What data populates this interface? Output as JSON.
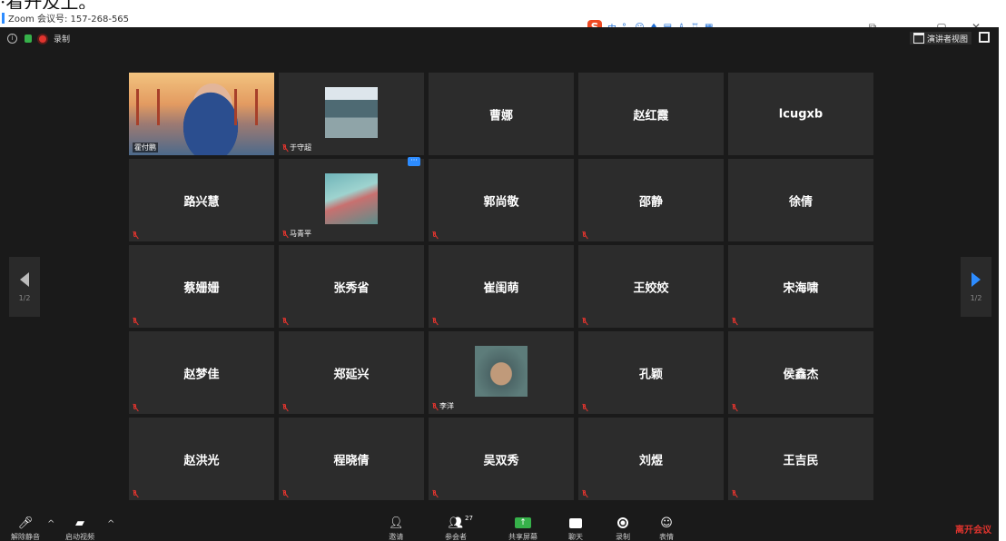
{
  "caption": "·看升及上。",
  "window": {
    "title": "Zoom 会议号: 157-268-565",
    "controls": [
      "—",
      "▢",
      "✕"
    ]
  },
  "ime_toolbar": {
    "logo": "S",
    "label": "中"
  },
  "meeting_header": {
    "recording_label": "录制",
    "speaker_view_label": "演讲者视图"
  },
  "pagination": {
    "left_page": "1/2",
    "right_page": "1/2"
  },
  "participants": [
    {
      "name": "霍付鹏",
      "type": "video",
      "muted": false,
      "active": true
    },
    {
      "name": "于守超",
      "type": "avatar",
      "avatar": "classroom",
      "muted": true
    },
    {
      "name": "曹娜",
      "type": "name",
      "muted": false
    },
    {
      "name": "赵红霞",
      "type": "name",
      "muted": false
    },
    {
      "name": "lcugxb",
      "type": "name",
      "muted": false
    },
    {
      "name": "路兴慧",
      "type": "name",
      "muted": true
    },
    {
      "name": "马青平",
      "type": "avatar",
      "avatar": "girl",
      "muted": true,
      "more": "···"
    },
    {
      "name": "郭尚敬",
      "type": "name",
      "muted": true
    },
    {
      "name": "邵静",
      "type": "name",
      "muted": true
    },
    {
      "name": "徐倩",
      "type": "name",
      "muted": false
    },
    {
      "name": "蔡姗姗",
      "type": "name",
      "muted": true
    },
    {
      "name": "张秀省",
      "type": "name",
      "muted": true
    },
    {
      "name": "崔闺萌",
      "type": "name",
      "muted": true
    },
    {
      "name": "王姣姣",
      "type": "name",
      "muted": true
    },
    {
      "name": "宋海啸",
      "type": "name",
      "muted": true
    },
    {
      "name": "赵梦佳",
      "type": "name",
      "muted": true
    },
    {
      "name": "郑延兴",
      "type": "name",
      "muted": true
    },
    {
      "name": "李洋",
      "type": "avatar",
      "avatar": "soldier",
      "muted": true
    },
    {
      "name": "孔颖",
      "type": "name",
      "muted": true
    },
    {
      "name": "侯鑫杰",
      "type": "name",
      "muted": true
    },
    {
      "name": "赵洪光",
      "type": "name",
      "muted": true
    },
    {
      "name": "程晓倩",
      "type": "name",
      "muted": true
    },
    {
      "name": "吴双秀",
      "type": "name",
      "muted": true
    },
    {
      "name": "刘煜",
      "type": "name",
      "muted": true
    },
    {
      "name": "王吉民",
      "type": "name",
      "muted": true
    }
  ],
  "toolbar": {
    "unmute_label": "解除静音",
    "start_video_label": "启动视频",
    "invite_label": "邀请",
    "participants_label": "参会者",
    "participants_count": "27",
    "share_label": "共享屏幕",
    "chat_label": "聊天",
    "record_label": "录制",
    "reactions_label": "表情",
    "leave_label": "离开会议"
  }
}
